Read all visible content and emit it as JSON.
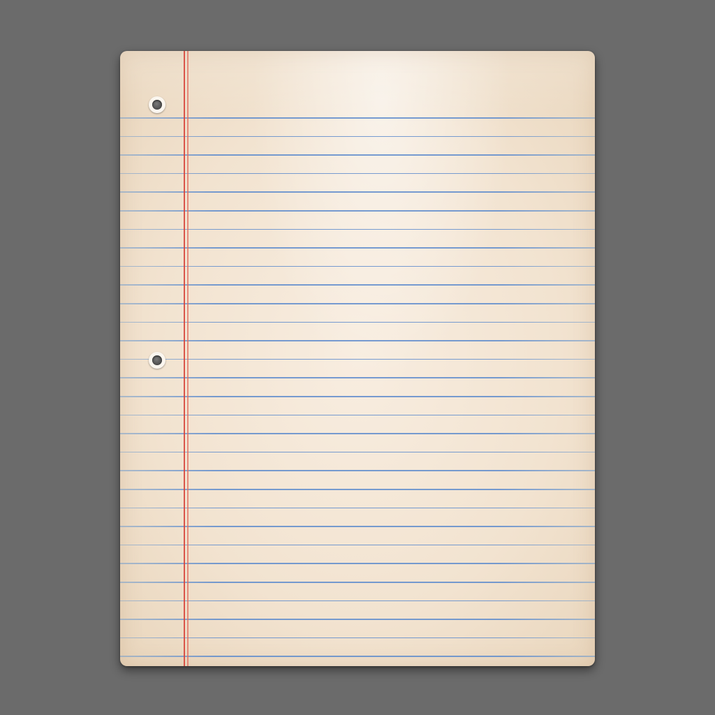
{
  "scene": {
    "subject": "blank-lined-paper",
    "background_color": "#6b6b6b",
    "paper_color": "#f4e6d3",
    "rule_line_color": "#5f8ccd",
    "margin_line_color": "#d7463c",
    "rule_line_count": 30,
    "punch_hole_count": 2,
    "icons": [
      "punch-hole-icon"
    ]
  }
}
